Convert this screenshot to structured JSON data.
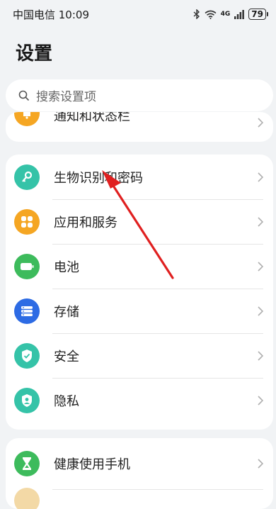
{
  "status": {
    "carrier_time": "中国电信 10:09",
    "network": "4G",
    "battery": "79"
  },
  "title": "设置",
  "search": {
    "placeholder": "搜索设置项"
  },
  "items": [
    {
      "label": "通知和状态栏",
      "icon": "bell-icon",
      "color": "#f5a623"
    },
    {
      "label": "生物识别和密码",
      "icon": "key-icon",
      "color": "#35c3a8"
    },
    {
      "label": "应用和服务",
      "icon": "apps-icon",
      "color": "#f5a623"
    },
    {
      "label": "电池",
      "icon": "battery-icon",
      "color": "#3dbb5c"
    },
    {
      "label": "存储",
      "icon": "storage-icon",
      "color": "#2d6be4"
    },
    {
      "label": "安全",
      "icon": "shield-icon",
      "color": "#35c3a8"
    },
    {
      "label": "隐私",
      "icon": "privacy-icon",
      "color": "#35c3a8"
    },
    {
      "label": "健康使用手机",
      "icon": "hourglass-icon",
      "color": "#3dbb5c"
    }
  ],
  "annotation": {
    "color": "#e02020"
  }
}
